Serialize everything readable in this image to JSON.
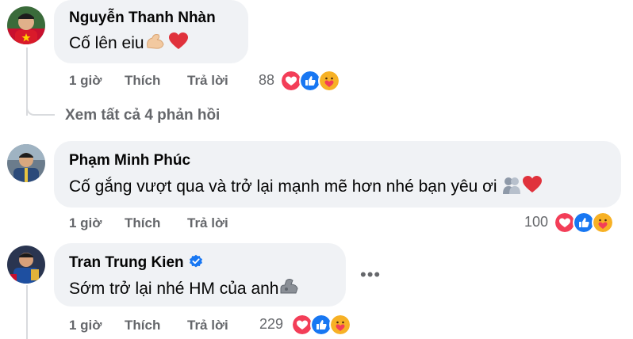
{
  "comments": [
    {
      "author": "Nguyễn Thanh Nhàn",
      "text": "Cố lên eiu",
      "time": "1 giờ",
      "like": "Thích",
      "reply": "Trả lời",
      "reaction_count": "88",
      "reactions": [
        "love",
        "like",
        "care"
      ]
    },
    {
      "author": "Phạm Minh Phúc",
      "text": "Cố gắng vượt qua và trở lại mạnh mẽ hơn nhé bạn yêu ơi",
      "time": "1 giờ",
      "like": "Thích",
      "reply": "Trả lời",
      "reaction_count": "100",
      "reactions": [
        "love",
        "like",
        "care"
      ]
    },
    {
      "author": "Tran Trung Kien",
      "verified": true,
      "text": "Sớm trở lại nhé HM của anh",
      "time": "1 giờ",
      "like": "Thích",
      "reply": "Trả lời",
      "reaction_count": "229",
      "reactions": [
        "love",
        "like",
        "care"
      ]
    }
  ],
  "view_replies": "Xem tất cả 4 phản hồi",
  "more_options": "•••",
  "colors": {
    "bubble": "#f0f2f5",
    "secondary_text": "#65676b",
    "love": "#f33e58",
    "like": "#1877f2",
    "care": "#f7b125"
  }
}
